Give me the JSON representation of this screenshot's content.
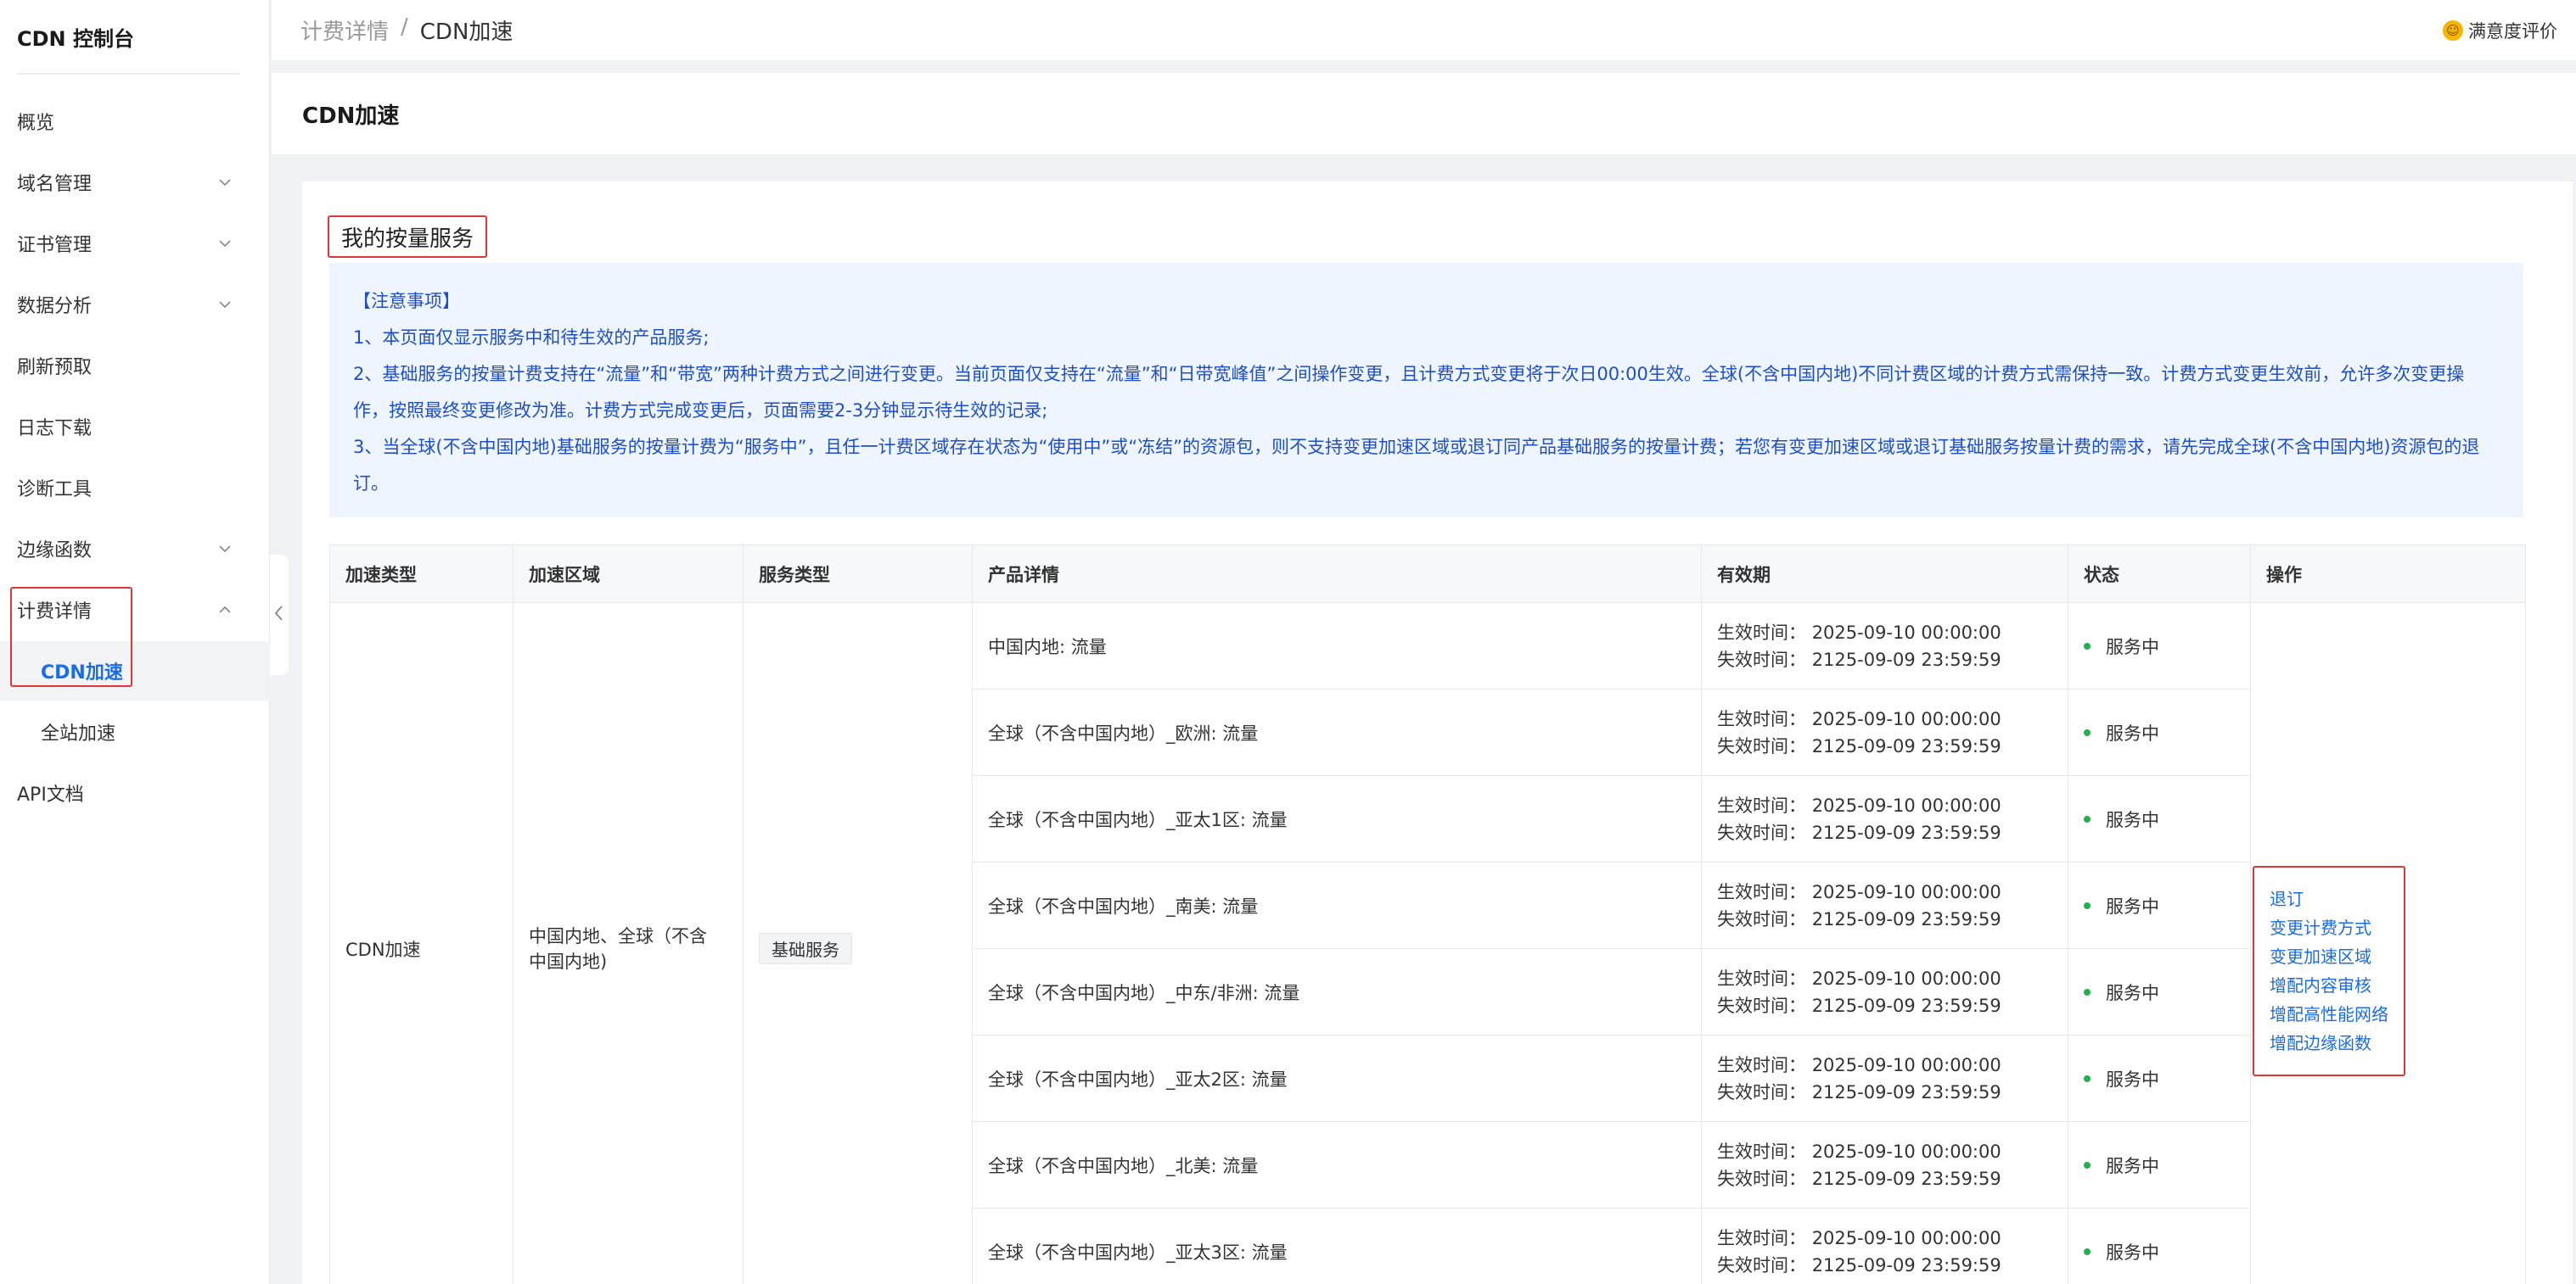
{
  "sidebar": {
    "brand": "CDN 控制台",
    "items": [
      {
        "label": "概览"
      },
      {
        "label": "域名管理"
      },
      {
        "label": "证书管理"
      },
      {
        "label": "数据分析"
      },
      {
        "label": "刷新预取"
      },
      {
        "label": "日志下载"
      },
      {
        "label": "诊断工具"
      },
      {
        "label": "边缘函数"
      },
      {
        "label": "计费详情"
      },
      {
        "label": "API文档"
      }
    ],
    "sub": {
      "cdn": "CDN加速",
      "site": "全站加速"
    }
  },
  "topbar": {
    "crumb_parent": "计费详情",
    "crumb_sep": "/",
    "crumb_current": "CDN加速",
    "satisfaction": "满意度评价"
  },
  "page": {
    "title": "CDN加速"
  },
  "section": {
    "title": "我的按量服务"
  },
  "notice": {
    "heading": "【注意事项】",
    "line1": "1、本页面仅显示服务中和待生效的产品服务;",
    "line2": "2、基础服务的按量计费支持在“流量”和“带宽”两种计费方式之间进行变更。当前页面仅支持在“流量”和“日带宽峰值”之间操作变更，且计费方式变更将于次日00:00生效。全球(不含中国内地)不同计费区域的计费方式需保持一致。计费方式变更生效前，允许多次变更操作，按照最终变更修改为准。计费方式完成变更后，页面需要2-3分钟显示待生效的记录;",
    "line3": "3、当全球(不含中国内地)基础服务的按量计费为“服务中”，且任一计费区域存在状态为“使用中”或“冻结”的资源包，则不支持变更加速区域或退订同产品基础服务的按量计费；若您有变更加速区域或退订基础服务按量计费的需求，请先完成全球(不含中国内地)资源包的退订。"
  },
  "table": {
    "headers": [
      "加速类型",
      "加速区域",
      "服务类型",
      "产品详情",
      "有效期",
      "状态",
      "操作"
    ],
    "accel_type": "CDN加速",
    "accel_region": "中国内地、全球（不含中国内地)",
    "service_type": "基础服务",
    "eff_label": "生效时间：",
    "exp_label": "失效时间：",
    "rows": [
      {
        "product": "中国内地: 流量",
        "eff": "2025-09-10 00:00:00",
        "exp": "2125-09-09 23:59:59",
        "status": "服务中"
      },
      {
        "product": "全球（不含中国内地）_欧洲: 流量",
        "eff": "2025-09-10 00:00:00",
        "exp": "2125-09-09 23:59:59",
        "status": "服务中"
      },
      {
        "product": "全球（不含中国内地）_亚太1区: 流量",
        "eff": "2025-09-10 00:00:00",
        "exp": "2125-09-09 23:59:59",
        "status": "服务中"
      },
      {
        "product": "全球（不含中国内地）_南美: 流量",
        "eff": "2025-09-10 00:00:00",
        "exp": "2125-09-09 23:59:59",
        "status": "服务中"
      },
      {
        "product": "全球（不含中国内地）_中东/非洲: 流量",
        "eff": "2025-09-10 00:00:00",
        "exp": "2125-09-09 23:59:59",
        "status": "服务中"
      },
      {
        "product": "全球（不含中国内地）_亚太2区: 流量",
        "eff": "2025-09-10 00:00:00",
        "exp": "2125-09-09 23:59:59",
        "status": "服务中"
      },
      {
        "product": "全球（不含中国内地）_北美: 流量",
        "eff": "2025-09-10 00:00:00",
        "exp": "2125-09-09 23:59:59",
        "status": "服务中"
      },
      {
        "product": "全球（不含中国内地）_亚太3区: 流量",
        "eff": "2025-09-10 00:00:00",
        "exp": "2125-09-09 23:59:59",
        "status": "服务中"
      }
    ],
    "actions": [
      "退订",
      "变更计费方式",
      "变更加速区域",
      "增配内容审核",
      "增配高性能网络",
      "增配边缘函数"
    ]
  },
  "colors": {
    "accent": "#1a6ce8",
    "highlight": "#e0353b",
    "status_ok": "#23b14d",
    "notice_bg": "#eef5ff"
  }
}
